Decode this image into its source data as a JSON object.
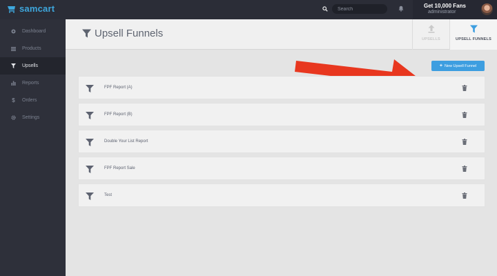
{
  "app": {
    "name": "samcart"
  },
  "search": {
    "placeholder": "Search"
  },
  "user": {
    "name": "Get 10,000 Fans",
    "role": "administrator"
  },
  "sidebar": {
    "items": [
      {
        "label": "Dashboard",
        "icon": "dashboard-icon",
        "active": false
      },
      {
        "label": "Products",
        "icon": "list-icon",
        "active": false
      },
      {
        "label": "Upsells",
        "icon": "funnel-icon",
        "active": true
      },
      {
        "label": "Reports",
        "icon": "bar-chart-icon",
        "active": false
      },
      {
        "label": "Orders",
        "icon": "dollar-icon",
        "active": false
      },
      {
        "label": "Settings",
        "icon": "gear-icon",
        "active": false
      }
    ]
  },
  "header": {
    "title": "Upsell Funnels",
    "tabs": [
      {
        "label": "UPSELLS",
        "icon": "upload-arrow-icon",
        "active": false
      },
      {
        "label": "UPSELL FUNNELS",
        "icon": "funnel-icon",
        "active": true
      }
    ]
  },
  "actions": {
    "new_funnel_label": "New Upsell Funnel"
  },
  "funnels": [
    {
      "name": "FPF Report (A)"
    },
    {
      "name": "FPF Report (B)"
    },
    {
      "name": "Double Your List Report"
    },
    {
      "name": "FPF Report Sale"
    },
    {
      "name": "Test"
    }
  ],
  "colors": {
    "accent": "#3d9ee0",
    "annotation_arrow": "#e8371f",
    "sidebar_bg": "#2e303a",
    "content_bg": "#e4e4e4"
  }
}
